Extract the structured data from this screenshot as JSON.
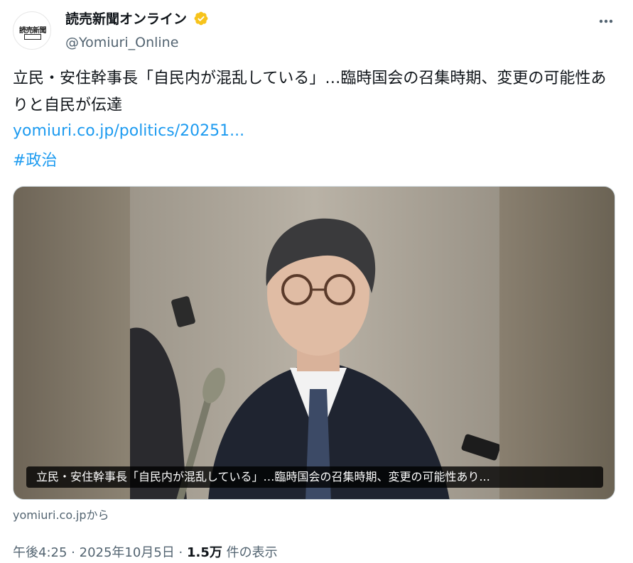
{
  "account": {
    "display_name": "読売新聞オンライン",
    "handle": "@Yomiuri_Online",
    "avatar_logo": "読売新聞",
    "avatar_sub": "オンライン",
    "verified_icon": "verified-badge-icon",
    "verified_color": "#f7c31b"
  },
  "tweet": {
    "text": "立民・安住幹事長「自民内が混乱している」…臨時国会の召集時期、変更の可能性ありと自民が伝達",
    "link": "yomiuri.co.jp/politics/20251...",
    "hashtag": "#政治"
  },
  "card": {
    "caption": "立民・安住幹事長「自民内が混乱している」…臨時国会の召集時期、変更の可能性あり...",
    "source": "yomiuri.co.jpから"
  },
  "meta": {
    "time": "午後4:25",
    "sep": "·",
    "date": "2025年10月5日",
    "views_count": "1.5万",
    "views_label": "件の表示"
  },
  "colors": {
    "link": "#1d9bf0",
    "secondary_text": "#536471",
    "primary_text": "#0f1419"
  }
}
